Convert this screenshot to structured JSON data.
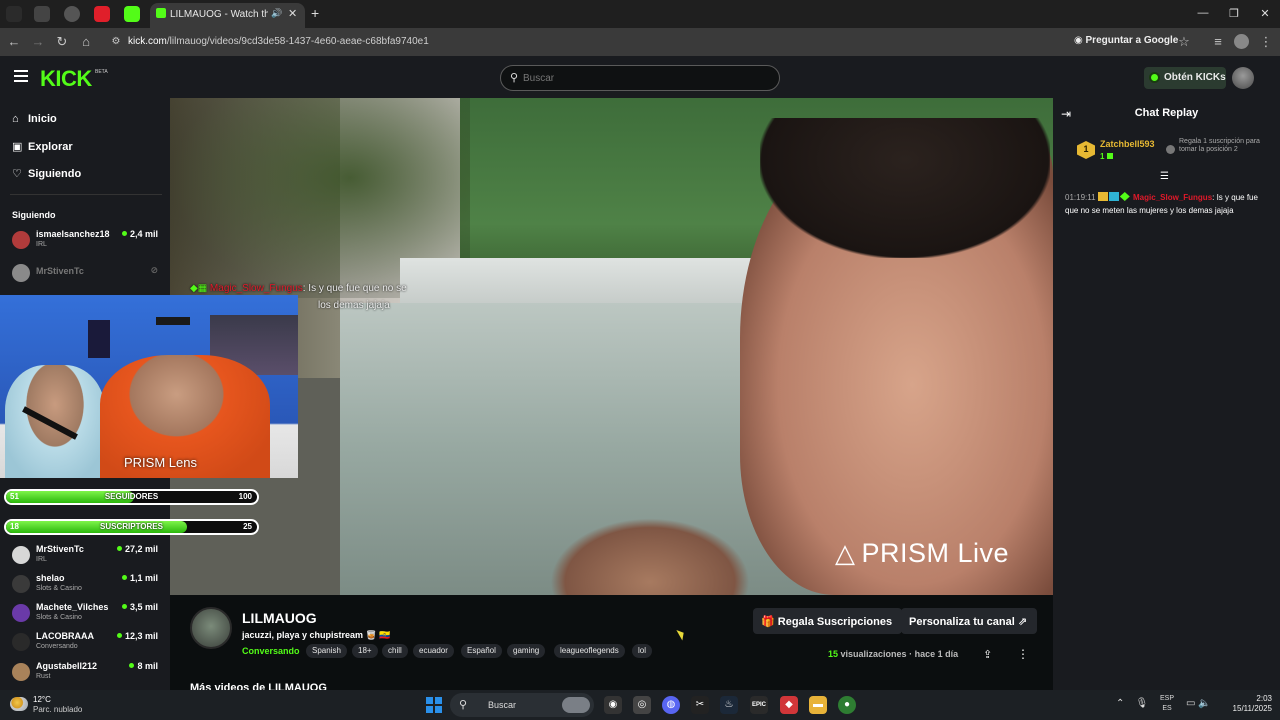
{
  "browser": {
    "active_tab_title": "LILMAUOG - Watch the VO",
    "url_host": "kick.com",
    "url_path": "/lilmauog/videos/9cd3de58-1437-4e60-aeae-c68bfa9740e1",
    "translate_label": "Preguntar a Google"
  },
  "header": {
    "logo": "KICK",
    "beta": "BETA",
    "search_placeholder": "Buscar",
    "kicks_label": "Obtén KICKs"
  },
  "sidebar": {
    "nav": [
      {
        "label": "Inicio",
        "icon": "home-icon"
      },
      {
        "label": "Explorar",
        "icon": "compass-icon"
      },
      {
        "label": "Siguiendo",
        "icon": "heart-icon"
      }
    ],
    "following_title": "Siguiendo",
    "following": [
      {
        "name": "ismaelsanchez18",
        "category": "IRL",
        "viewers": "2,4 mil",
        "live": true,
        "color": "#b13b3b"
      },
      {
        "name": "MrStivenTc",
        "category": "",
        "viewers": "",
        "live": false,
        "color": "#8a8a8a"
      },
      {
        "name": "MrStivenTc",
        "category": "IRL",
        "viewers": "27,2 mil",
        "live": true,
        "color": "#d7d7d7"
      },
      {
        "name": "shelao",
        "category": "Slots & Casino",
        "viewers": "1,1 mil",
        "live": true,
        "color": "#3a3a3a"
      },
      {
        "name": "Machete_Vilches",
        "category": "Slots & Casino",
        "viewers": "3,5 mil",
        "live": true,
        "color": "#6a3aa8"
      },
      {
        "name": "LACOBRAAA",
        "category": "Conversando",
        "viewers": "12,3 mil",
        "live": true,
        "color": "#2a2a2a"
      },
      {
        "name": "Agustabell212",
        "category": "Rust",
        "viewers": "8 mil",
        "live": true,
        "color": "#a8825a"
      }
    ]
  },
  "video": {
    "overlay_user": "Magic_Slow_Fungus",
    "overlay_msg_1": ": Is y que fue que no se",
    "overlay_msg_2": "los demas jajaja",
    "prism_live": "PRISM Live",
    "prism_lens": "PRISM Lens",
    "goals": [
      {
        "label": "SEGUIDORES",
        "current": "51",
        "target": "100",
        "progress": 0.51
      },
      {
        "label": "SUSCRIPTORES",
        "current": "18",
        "target": "25",
        "progress": 0.72
      }
    ]
  },
  "channel": {
    "name": "LILMAUOG",
    "title": "jacuzzi, playa y chupistream 🥃 🇪🇨",
    "category": "Conversando",
    "tags": [
      "Spanish",
      "18+",
      "chill",
      "ecuador",
      "Español",
      "gaming",
      "leagueoflegends",
      "lol"
    ],
    "gift_button": "Regala Suscripciones",
    "customize_button": "Personaliza tu canal",
    "views_count": "15",
    "views_label": "visualizaciones",
    "age": "hace 1 día",
    "more_videos": "Más videos de LILMAUOG"
  },
  "chat": {
    "title": "Chat Replay",
    "pinned": {
      "rank": "1",
      "user": "Zatchbell593",
      "subs": "1",
      "gift_text": "Regala 1 suscripción para tomar la posición 2"
    },
    "messages": [
      {
        "time": "01:19:11",
        "user": "Magic_Slow_Fungus",
        "text": ": Is y que fue que no se meten las mujeres y los demas jajaja"
      }
    ]
  },
  "taskbar": {
    "temp": "12°C",
    "weather": "Parc. nublado",
    "search_label": "Buscar",
    "lang_1": "ESP",
    "lang_2": "ES",
    "time": "2:03",
    "date": "15/11/2025"
  },
  "colors": {
    "kick_green": "#53fc18",
    "background": "#0b0e0f",
    "panel": "#191b1f",
    "chat_user_red": "#e0192a",
    "rank_gold": "#e7b933"
  }
}
